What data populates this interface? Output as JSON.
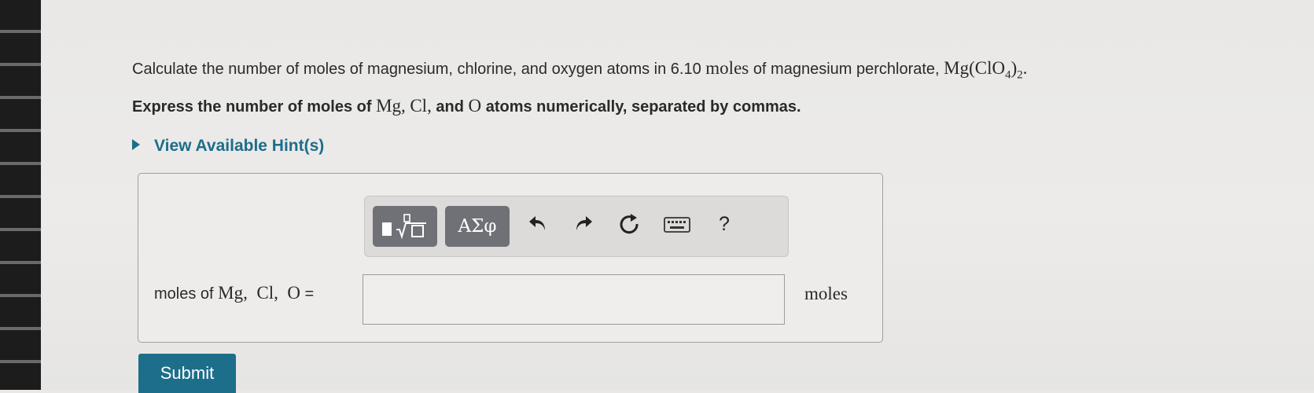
{
  "question": {
    "line1_text": "Calculate the number of moles of magnesium, chlorine, and oxygen atoms in 6.10",
    "line1_unit": "moles",
    "line1_mid": "of magnesium perchlorate,",
    "formula_main": "Mg(ClO",
    "formula_sub1": "4",
    "formula_close": ")",
    "formula_sub2": "2",
    "formula_end": ".",
    "line2_a": "Express the number of moles of",
    "mg": "Mg,",
    "cl": "Cl,",
    "line2_and": "and",
    "o": "O",
    "line2_b": "atoms numerically, separated by commas."
  },
  "hint": {
    "label": "View Available Hint(s)"
  },
  "toolbar": {
    "symbols_label": "ΑΣφ",
    "help_label": "?"
  },
  "answer": {
    "label_prefix": "moles of",
    "label_math": "Mg,  Cl,  O",
    "label_eq": "=",
    "value": "",
    "unit": "moles"
  },
  "submit": {
    "label": "Submit"
  },
  "colors": {
    "accent": "#1d6e8a",
    "tool_button": "#6f7176"
  }
}
